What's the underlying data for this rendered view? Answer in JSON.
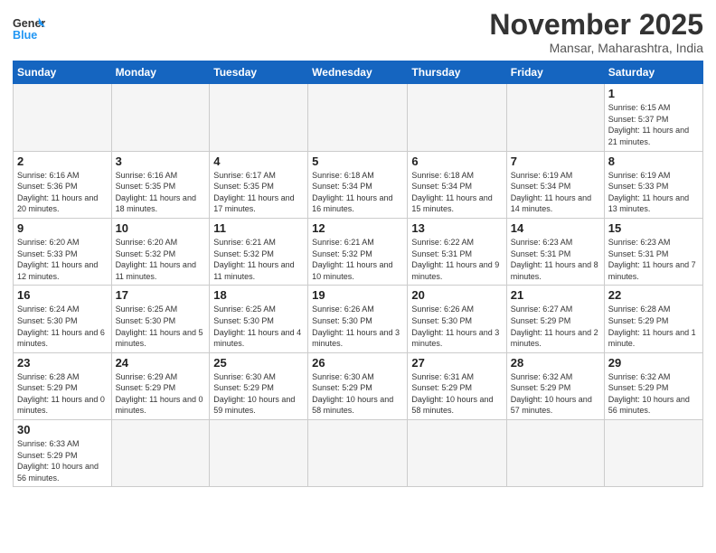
{
  "header": {
    "logo_general": "General",
    "logo_blue": "Blue",
    "month_title": "November 2025",
    "location": "Mansar, Maharashtra, India"
  },
  "weekdays": [
    "Sunday",
    "Monday",
    "Tuesday",
    "Wednesday",
    "Thursday",
    "Friday",
    "Saturday"
  ],
  "weeks": [
    [
      {
        "day": "",
        "info": ""
      },
      {
        "day": "",
        "info": ""
      },
      {
        "day": "",
        "info": ""
      },
      {
        "day": "",
        "info": ""
      },
      {
        "day": "",
        "info": ""
      },
      {
        "day": "",
        "info": ""
      },
      {
        "day": "1",
        "info": "Sunrise: 6:15 AM\nSunset: 5:37 PM\nDaylight: 11 hours\nand 21 minutes."
      }
    ],
    [
      {
        "day": "2",
        "info": "Sunrise: 6:16 AM\nSunset: 5:36 PM\nDaylight: 11 hours\nand 20 minutes."
      },
      {
        "day": "3",
        "info": "Sunrise: 6:16 AM\nSunset: 5:35 PM\nDaylight: 11 hours\nand 18 minutes."
      },
      {
        "day": "4",
        "info": "Sunrise: 6:17 AM\nSunset: 5:35 PM\nDaylight: 11 hours\nand 17 minutes."
      },
      {
        "day": "5",
        "info": "Sunrise: 6:18 AM\nSunset: 5:34 PM\nDaylight: 11 hours\nand 16 minutes."
      },
      {
        "day": "6",
        "info": "Sunrise: 6:18 AM\nSunset: 5:34 PM\nDaylight: 11 hours\nand 15 minutes."
      },
      {
        "day": "7",
        "info": "Sunrise: 6:19 AM\nSunset: 5:34 PM\nDaylight: 11 hours\nand 14 minutes."
      },
      {
        "day": "8",
        "info": "Sunrise: 6:19 AM\nSunset: 5:33 PM\nDaylight: 11 hours\nand 13 minutes."
      }
    ],
    [
      {
        "day": "9",
        "info": "Sunrise: 6:20 AM\nSunset: 5:33 PM\nDaylight: 11 hours\nand 12 minutes."
      },
      {
        "day": "10",
        "info": "Sunrise: 6:20 AM\nSunset: 5:32 PM\nDaylight: 11 hours\nand 11 minutes."
      },
      {
        "day": "11",
        "info": "Sunrise: 6:21 AM\nSunset: 5:32 PM\nDaylight: 11 hours\nand 11 minutes."
      },
      {
        "day": "12",
        "info": "Sunrise: 6:21 AM\nSunset: 5:32 PM\nDaylight: 11 hours\nand 10 minutes."
      },
      {
        "day": "13",
        "info": "Sunrise: 6:22 AM\nSunset: 5:31 PM\nDaylight: 11 hours\nand 9 minutes."
      },
      {
        "day": "14",
        "info": "Sunrise: 6:23 AM\nSunset: 5:31 PM\nDaylight: 11 hours\nand 8 minutes."
      },
      {
        "day": "15",
        "info": "Sunrise: 6:23 AM\nSunset: 5:31 PM\nDaylight: 11 hours\nand 7 minutes."
      }
    ],
    [
      {
        "day": "16",
        "info": "Sunrise: 6:24 AM\nSunset: 5:30 PM\nDaylight: 11 hours\nand 6 minutes."
      },
      {
        "day": "17",
        "info": "Sunrise: 6:25 AM\nSunset: 5:30 PM\nDaylight: 11 hours\nand 5 minutes."
      },
      {
        "day": "18",
        "info": "Sunrise: 6:25 AM\nSunset: 5:30 PM\nDaylight: 11 hours\nand 4 minutes."
      },
      {
        "day": "19",
        "info": "Sunrise: 6:26 AM\nSunset: 5:30 PM\nDaylight: 11 hours\nand 3 minutes."
      },
      {
        "day": "20",
        "info": "Sunrise: 6:26 AM\nSunset: 5:30 PM\nDaylight: 11 hours\nand 3 minutes."
      },
      {
        "day": "21",
        "info": "Sunrise: 6:27 AM\nSunset: 5:29 PM\nDaylight: 11 hours\nand 2 minutes."
      },
      {
        "day": "22",
        "info": "Sunrise: 6:28 AM\nSunset: 5:29 PM\nDaylight: 11 hours\nand 1 minute."
      }
    ],
    [
      {
        "day": "23",
        "info": "Sunrise: 6:28 AM\nSunset: 5:29 PM\nDaylight: 11 hours\nand 0 minutes."
      },
      {
        "day": "24",
        "info": "Sunrise: 6:29 AM\nSunset: 5:29 PM\nDaylight: 11 hours\nand 0 minutes."
      },
      {
        "day": "25",
        "info": "Sunrise: 6:30 AM\nSunset: 5:29 PM\nDaylight: 10 hours\nand 59 minutes."
      },
      {
        "day": "26",
        "info": "Sunrise: 6:30 AM\nSunset: 5:29 PM\nDaylight: 10 hours\nand 58 minutes."
      },
      {
        "day": "27",
        "info": "Sunrise: 6:31 AM\nSunset: 5:29 PM\nDaylight: 10 hours\nand 58 minutes."
      },
      {
        "day": "28",
        "info": "Sunrise: 6:32 AM\nSunset: 5:29 PM\nDaylight: 10 hours\nand 57 minutes."
      },
      {
        "day": "29",
        "info": "Sunrise: 6:32 AM\nSunset: 5:29 PM\nDaylight: 10 hours\nand 56 minutes."
      }
    ],
    [
      {
        "day": "30",
        "info": "Sunrise: 6:33 AM\nSunset: 5:29 PM\nDaylight: 10 hours\nand 56 minutes."
      },
      {
        "day": "",
        "info": ""
      },
      {
        "day": "",
        "info": ""
      },
      {
        "day": "",
        "info": ""
      },
      {
        "day": "",
        "info": ""
      },
      {
        "day": "",
        "info": ""
      },
      {
        "day": "",
        "info": ""
      }
    ]
  ]
}
